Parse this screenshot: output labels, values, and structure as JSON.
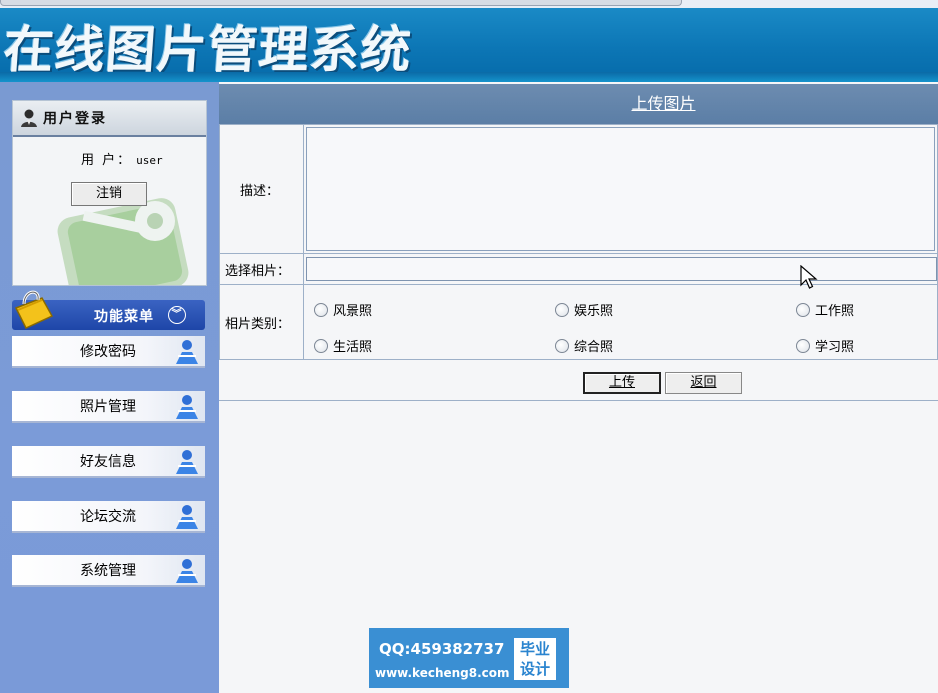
{
  "banner": {
    "title": "在线图片管理系统"
  },
  "login": {
    "header": "用户登录",
    "user_label": "用 户：",
    "user_value": "user",
    "logout_label": "注销"
  },
  "menu": {
    "header": "功能菜单",
    "items": [
      {
        "label": "修改密码"
      },
      {
        "label": "照片管理"
      },
      {
        "label": "好友信息"
      },
      {
        "label": "论坛交流"
      },
      {
        "label": "系统管理"
      }
    ]
  },
  "upload": {
    "title": "上传图片",
    "desc_label": "描述：",
    "file_label": "选择相片：",
    "category_label": "相片类别：",
    "categories": [
      "风景照",
      "娱乐照",
      "工作照",
      "生活照",
      "综合照",
      "学习照"
    ],
    "submit_label": "上传",
    "back_label": "返回"
  },
  "watermark": {
    "qq": "QQ:459382737",
    "url": "www.kecheng8.com",
    "badge_line1": "毕业",
    "badge_line2": "设计"
  },
  "colors": {
    "banner": "#0c76b5",
    "sidebar": "#7a9ad2",
    "upload_header": "#6485ab",
    "watermark": "#3a8fd3"
  }
}
